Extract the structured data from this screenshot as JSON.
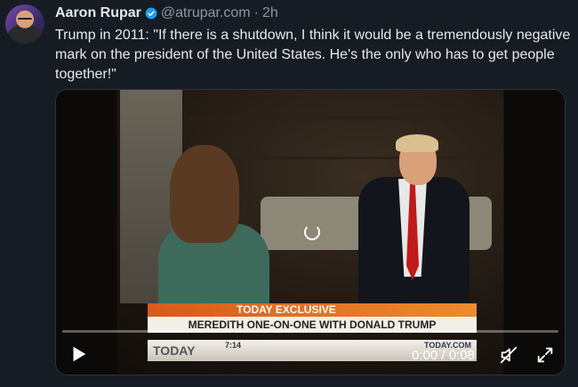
{
  "author": {
    "name": "Aaron Rupar",
    "handle": "@atrupar.com",
    "separator": "·",
    "time": "2h"
  },
  "post": {
    "text": "Trump in 2011: \"If there is a shutdown, I think it would be a tremendously negative mark on the president of the United States. He's the only who has to get people together!\""
  },
  "video": {
    "lower_third": {
      "banner": "TODAY EXCLUSIVE",
      "headline": "MEREDITH ONE-ON-ONE WITH DONALD TRUMP",
      "logo": "TODAY",
      "clock": "7:14",
      "site": "TODAY.COM"
    },
    "time_readout": "0:00 / 0:08",
    "progress": 0.0
  },
  "icons": {
    "verified": "verified-badge-icon",
    "play": "play-icon",
    "mute": "volume-muted-icon",
    "fullscreen": "fullscreen-icon",
    "loading": "loading-spinner-icon"
  },
  "colors": {
    "background": "#161c24",
    "verified": "#1d9bf0",
    "muted_text": "#8b98a5"
  }
}
